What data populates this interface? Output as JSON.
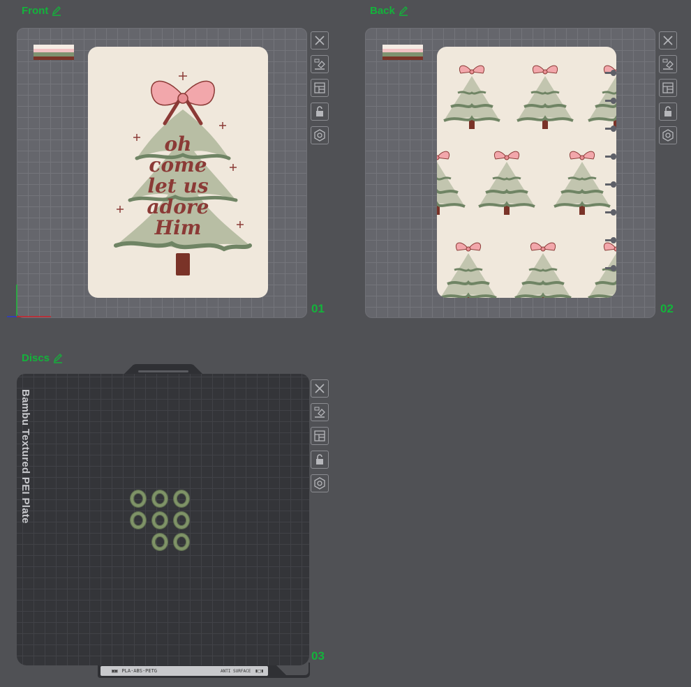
{
  "plates": [
    {
      "name": "Front",
      "number": "01"
    },
    {
      "name": "Back",
      "number": "02"
    },
    {
      "name": "Discs",
      "number": "03"
    }
  ],
  "bed_label": "Bambu Textured PEI Plate",
  "plate_footer": {
    "material_text": "PLA·ABS·PETG",
    "surface_text": "ANTI SURFACE"
  },
  "card_text": [
    "oh",
    "come",
    "let us",
    "adore",
    "Him"
  ],
  "filament_colors": [
    "#f4ece4",
    "#f2c2c4",
    "#7e9270",
    "#7a3328"
  ],
  "colors": {
    "accent": "#13b33b",
    "bed": "#65666c",
    "dark_bed": "#343539",
    "card": "#f0e8dc",
    "disc": "#7f9367"
  },
  "toolbar_icons": [
    "close-icon",
    "auto-orient-icon",
    "arrange-icon",
    "lock-icon",
    "settings-icon"
  ]
}
